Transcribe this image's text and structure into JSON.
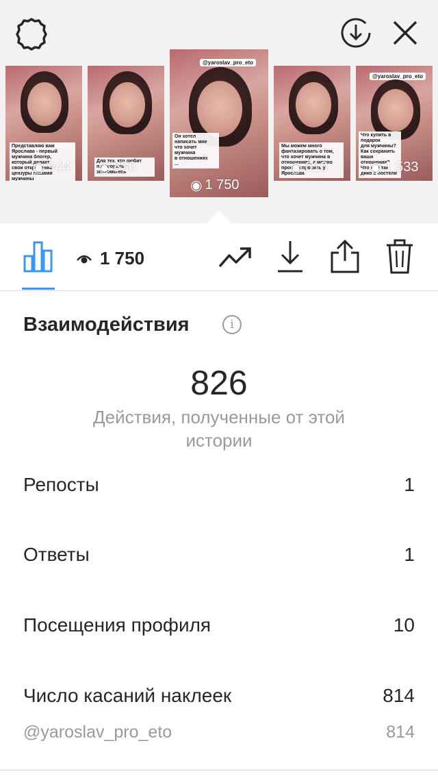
{
  "header": {
    "settings_icon": "gear-icon",
    "download_icon": "download-circle-icon",
    "close_icon": "close-icon"
  },
  "stories": [
    {
      "caption": "Представляю вам\nЯрослава - первый\nмужчина блогер,\nкоторый делает\nсвои откровения\nцензуры глазами\nмужчины",
      "views": "944",
      "handle": ""
    },
    {
      "caption": "Для тех, кто любит\nпоговорить -\nзнакомьтесь",
      "views": "838",
      "handle": ""
    },
    {
      "caption": "Он хотел\nнаписать мне\nчто хочет мужчина\nв отношениях\n...",
      "views": "1 750",
      "handle": "@yaroslav_pro_eto"
    },
    {
      "caption": "Мы можем много\nфантазировать о том,\nчто хочет мужчина в\nотношениях, а можно\nпросто спросить у\nЯрослава",
      "views": "610",
      "handle": ""
    },
    {
      "caption": "Что купить в подарок\nдля мужчины?\nКак сохранить\nваши отношения?\nЧто мне так\nдико в постели",
      "views": "1 533",
      "handle": "@yaroslav_pro_eto"
    }
  ],
  "tabbar": {
    "views_count": "1 750",
    "icons": [
      "bar-chart-icon",
      "eye-icon",
      "trending-icon",
      "download-icon",
      "share-icon",
      "trash-icon"
    ]
  },
  "interactions": {
    "title": "Взаимодействия",
    "total": "826",
    "total_label": "Действия, полученные от этой истории",
    "rows": [
      {
        "label": "Репосты",
        "value": "1"
      },
      {
        "label": "Ответы",
        "value": "1"
      },
      {
        "label": "Посещения профиля",
        "value": "10"
      },
      {
        "label": "Число касаний наклеек",
        "value": "814"
      }
    ],
    "sub_row": {
      "label": "@yaroslav_pro_eto",
      "value": "814"
    }
  },
  "colors": {
    "accent": "#3897f0",
    "text": "#262626",
    "muted": "#999999",
    "divider": "#dbdbdb"
  }
}
